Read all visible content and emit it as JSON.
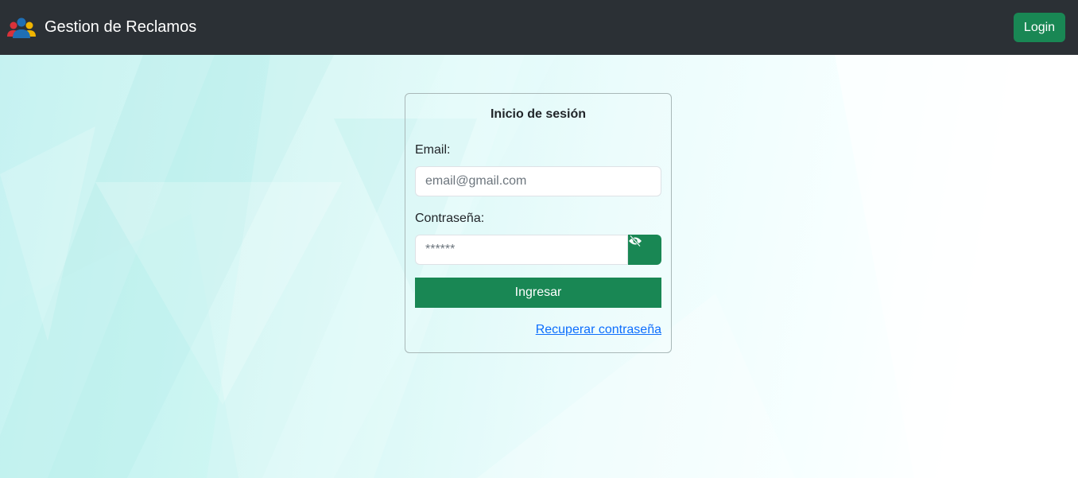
{
  "navbar": {
    "brand_title": "Gestion de Reclamos",
    "brand_icon": "people-group-icon",
    "login_label": "Login"
  },
  "login_card": {
    "title": "Inicio de sesión",
    "email_label": "Email:",
    "email_placeholder": "email@gmail.com",
    "password_label": "Contraseña:",
    "password_placeholder": "******",
    "toggle_icon": "eye-slash-icon",
    "submit_label": "Ingresar",
    "recover_link": "Recuperar contraseña"
  },
  "colors": {
    "navbar_bg": "#2b3035",
    "accent_green": "#198754",
    "link_blue": "#0d6efd",
    "background_tint": "#d5f7f5"
  }
}
